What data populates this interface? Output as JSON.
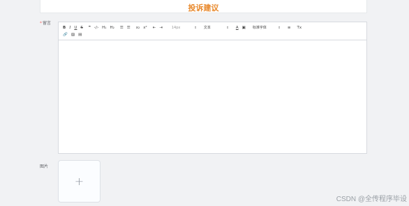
{
  "page": {
    "title": "投诉建议"
  },
  "form": {
    "content_label": "留言",
    "image_label": "图片",
    "upload_plus": "+"
  },
  "toolbar": {
    "bold": "B",
    "italic": "I",
    "underline": "U",
    "strike": "S",
    "blockquote": "❞",
    "code": "‹/›",
    "h1": "H₁",
    "h2": "H₂",
    "ordered_list": "☰",
    "bullet_list": "☰",
    "subscript": "x₂",
    "superscript": "x²",
    "indent_decrease": "⇤",
    "indent_increase": "⇥",
    "size_value": "14px",
    "header_value": "文本",
    "color": "A",
    "background": "▣",
    "font_value": "标准字体",
    "align": "≡",
    "clean": "Tx",
    "link": "🔗",
    "image": "▨",
    "video": "▤",
    "dropdown_arrow": "⇕"
  },
  "watermark": "CSDN @全传程序毕设",
  "colors": {
    "title_accent": "#e8882b",
    "background": "#f1f2f4",
    "border": "#d7dadf"
  }
}
